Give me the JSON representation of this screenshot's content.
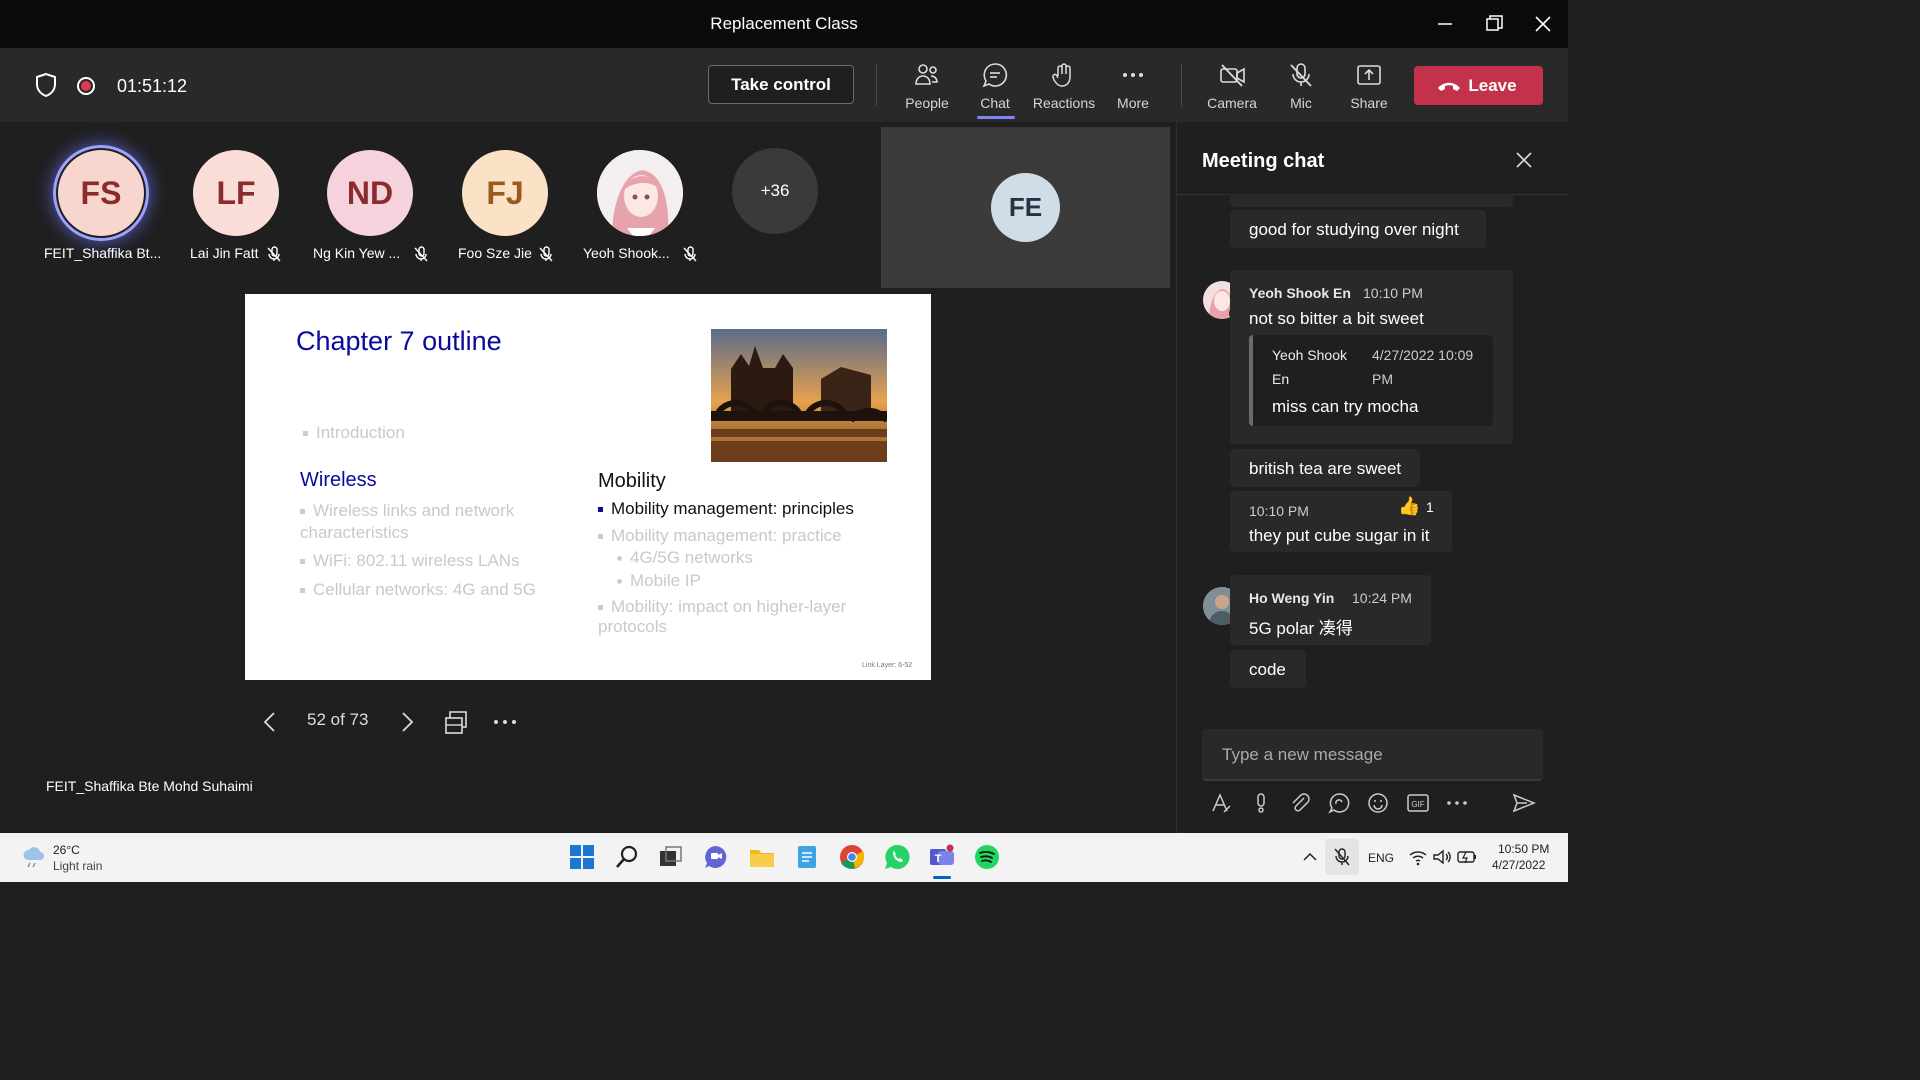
{
  "window": {
    "title": "Replacement Class"
  },
  "toolbar": {
    "timer": "01:51:12",
    "take_control": "Take control",
    "people": "People",
    "chat": "Chat",
    "reactions": "Reactions",
    "more": "More",
    "camera": "Camera",
    "mic": "Mic",
    "share": "Share",
    "leave": "Leave"
  },
  "participants": [
    {
      "initials": "FS",
      "name": "FEIT_Shaffika Bt...",
      "bg": "#f7d6d0"
    },
    {
      "initials": "LF",
      "name": "Lai Jin Fatt",
      "bg": "#f9ddd6"
    },
    {
      "initials": "ND",
      "name": "Ng Kin Yew ...",
      "bg": "#f6d2dc"
    },
    {
      "initials": "FJ",
      "name": "Foo Sze Jie",
      "bg": "#fbe2c7"
    },
    {
      "initials": "",
      "name": "Yeoh Shook...",
      "bg": "#e8d8dc"
    }
  ],
  "overflow": "+36",
  "tile": {
    "initials": "FE"
  },
  "slide": {
    "title": "Chapter 7 outline",
    "intro": "Introduction",
    "left_heading": "Wireless",
    "left_items": [
      "Wireless links and network characteristics",
      "WiFi: 802.11 wireless LANs",
      "Cellular networks: 4G and 5G"
    ],
    "right_heading": "Mobility",
    "right_active": "Mobility management: principles",
    "right_items": [
      "Mobility management: practice",
      "4G/5G networks",
      "Mobile IP",
      "Mobility: impact on higher-layer protocols"
    ],
    "footer": "Link Layer: 6-52"
  },
  "slide_nav": {
    "counter": "52 of 73"
  },
  "presenter": "FEIT_Shaffika Bte Mohd Suhaimi",
  "chat": {
    "title": "Meeting chat",
    "messages": [
      {
        "text": "good for studying over night"
      },
      {
        "sender": "Yeoh Shook En",
        "time": "10:10 PM",
        "text": "not so bitter a bit sweet",
        "quote_sender_1": "Yeoh Shook",
        "quote_sender_2": "En",
        "quote_time_1": "4/27/2022 10:09",
        "quote_time_2": "PM",
        "quote_text": "miss can try mocha"
      },
      {
        "text": "british tea are sweet"
      },
      {
        "time": "10:10 PM",
        "reaction_count": "1",
        "text": "they put cube sugar in it"
      },
      {
        "sender": "Ho Weng Yin",
        "time": "10:24 PM",
        "text": "5G polar 凑得"
      },
      {
        "text": "code"
      }
    ],
    "placeholder": "Type a new message"
  },
  "taskbar": {
    "temp": "26°C",
    "weather": "Light rain",
    "lang": "ENG",
    "time": "10:50 PM",
    "date": "4/27/2022"
  },
  "colors": {
    "accent": "#7f85f5",
    "leave": "#c4314b",
    "tile_bg": "#3b3b3b"
  }
}
